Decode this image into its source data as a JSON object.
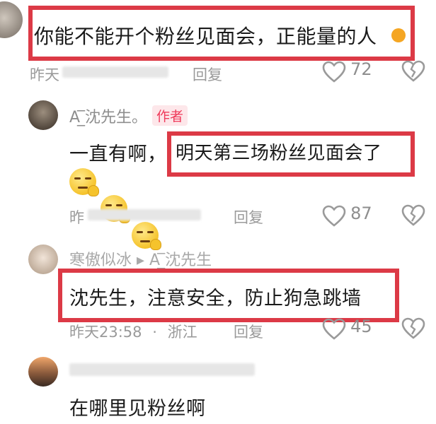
{
  "comments": [
    {
      "text": "你能不能开个粉丝见面会，正能量的人",
      "meta_time": "昨天",
      "reply_label": "回复",
      "likes": "72"
    },
    {
      "author": "A ̲̅沈先生。",
      "author_badge": "作者",
      "text_prefix": "一直有啊，",
      "text_highlight": "明天第三场粉丝见面会了",
      "meta_time": "昨",
      "reply_label": "回复",
      "likes": "87"
    },
    {
      "author": "寒傲似冰 ▸ A ̲̅沈先生",
      "text": "沈先生，注意安全，防止狗急跳墙",
      "meta_time": "昨天23:58",
      "meta_sep": "·",
      "meta_location": "浙江",
      "reply_label": "回复",
      "likes": "45"
    },
    {
      "text": "在哪里见粉丝啊"
    }
  ],
  "icons": [
    "heart-icon",
    "broken-heart-icon",
    "emoji-icon"
  ],
  "colors": {
    "highlight_border": "#dc3a46",
    "badge_bg": "#fde7ea",
    "badge_text": "#ef3b5b"
  }
}
